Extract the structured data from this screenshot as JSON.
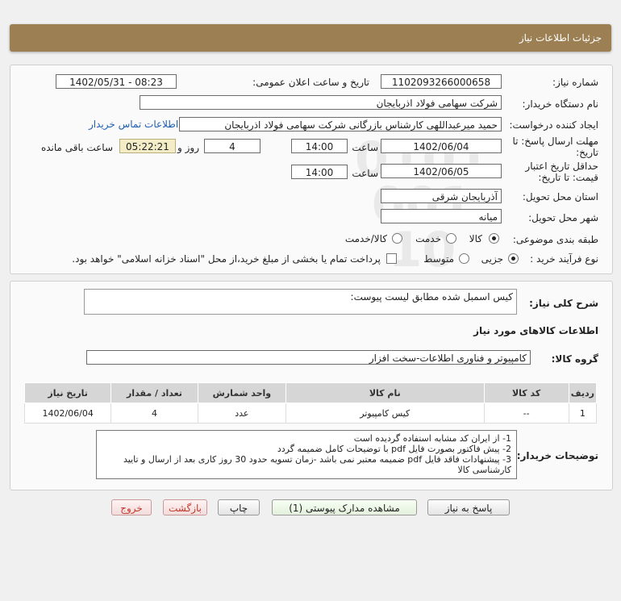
{
  "header": {
    "title": "جزئیات اطلاعات نیاز"
  },
  "form": {
    "need_number_label": "شماره نیاز:",
    "need_number": "1102093266000658",
    "announce_label": "تاریخ و ساعت اعلان عمومی:",
    "announce_value": "1402/05/31 - 08:23",
    "buyer_org_label": "نام دستگاه خریدار:",
    "buyer_org": "شرکت سهامی فولاد اذربایجان",
    "creator_label": "ایجاد کننده درخواست:",
    "creator": "حمید میرعبداللهی کارشناس بازرگانی شرکت سهامی فولاد اذربایجان",
    "contact_link": "اطلاعات تماس خریدار",
    "deadline_label_1": "مهلت ارسال پاسخ: تا",
    "deadline_label_2": "تاریخ:",
    "deadline_date": "1402/06/04",
    "time_label": "ساعت",
    "deadline_time": "14:00",
    "days_value": "4",
    "days_label": "روز و",
    "remaining_time": "05:22:21",
    "remaining_label": "ساعت باقی مانده",
    "validity_label_1": "حداقل تاریخ اعتبار",
    "validity_label_2": "قیمت: تا تاریخ:",
    "validity_date": "1402/06/05",
    "validity_time": "14:00",
    "province_label": "استان محل تحویل:",
    "province": "آذربایجان شرقی",
    "city_label": "شهر محل تحویل:",
    "city": "میانه",
    "category_label": "طبقه بندی موضوعی:",
    "category_options": [
      "کالا",
      "خدمت",
      "کالا/خدمت"
    ],
    "category_selected": 0,
    "process_label": "نوع فرآیند خرید :",
    "process_options": [
      "جزیی",
      "متوسط"
    ],
    "process_selected": 0,
    "payment_text": "پرداخت تمام یا بخشی از مبلغ خرید،از محل \"اسناد خزانه اسلامی\" خواهد بود."
  },
  "summary": {
    "label": "شرح کلی نیاز:",
    "value": "کیس اسمبل شده مطابق لیست پیوست:"
  },
  "goods": {
    "section_title": "اطلاعات کالاهای مورد نیاز",
    "group_label": "گروه کالا:",
    "group_value": "کامپیوتر و فناوری اطلاعات-سخت افزار",
    "columns": [
      "ردیف",
      "کد کالا",
      "نام کالا",
      "واحد شمارش",
      "تعداد / مقدار",
      "تاریخ نیاز"
    ],
    "rows": [
      [
        "1",
        "--",
        "کیس کامپیوتر",
        "عدد",
        "4",
        "1402/06/04"
      ]
    ]
  },
  "buyer_notes": {
    "label": "توضیحات خریدار:",
    "lines": [
      "1- از ایران کد مشابه استفاده گردیده است",
      "2- پیش فاکتور بصورت فایل pdf با توضیحات کامل ضمیمه گردد",
      "3- پیشنهادات فاقد فایل pdf  ضمیمه معتبر نمی باشد -زمان تسویه حدود 30  روز کاری بعد از ارسال و تایید کارشناسی کالا"
    ]
  },
  "buttons": {
    "reply": "پاسخ به نیاز",
    "attachments": "مشاهده مدارک پیوستی (1)",
    "print": "چاپ",
    "back": "بازگشت",
    "exit": "خروج"
  }
}
